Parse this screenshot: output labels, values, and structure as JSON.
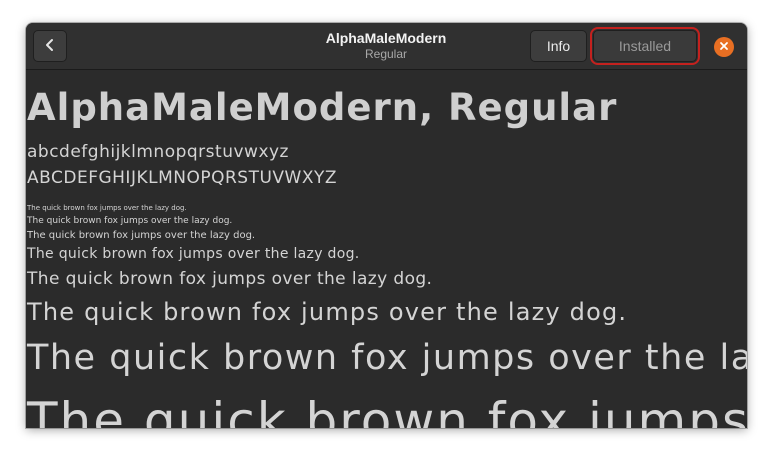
{
  "header": {
    "title": "AlphaMaleModern",
    "subtitle": "Regular",
    "info_label": "Info",
    "installed_label": "Installed",
    "back_icon": "chevron-left-icon",
    "close_icon": "close-icon",
    "close_color": "#e86f23",
    "highlight_color": "#c4211e"
  },
  "preview": {
    "heading": "AlphaMaleModern, Regular",
    "lowercase": "abcdefghijklmnopqrstuvwxyz",
    "uppercase": "ABCDEFGHIJKLMNOPQRSTUVWXYZ",
    "samples": [
      "The quick brown fox jumps over the lazy dog.",
      "The quick brown fox jumps over the lazy dog.",
      "The quick brown fox jumps over the lazy dog.",
      "The quick brown fox jumps over the lazy dog.",
      "The quick brown fox jumps over the lazy dog.",
      "The quick brown fox jumps over the lazy dog.",
      "The quick brown fox jumps over the lazy dog.",
      "The quick brown fox jumps over the lazy dog."
    ]
  }
}
